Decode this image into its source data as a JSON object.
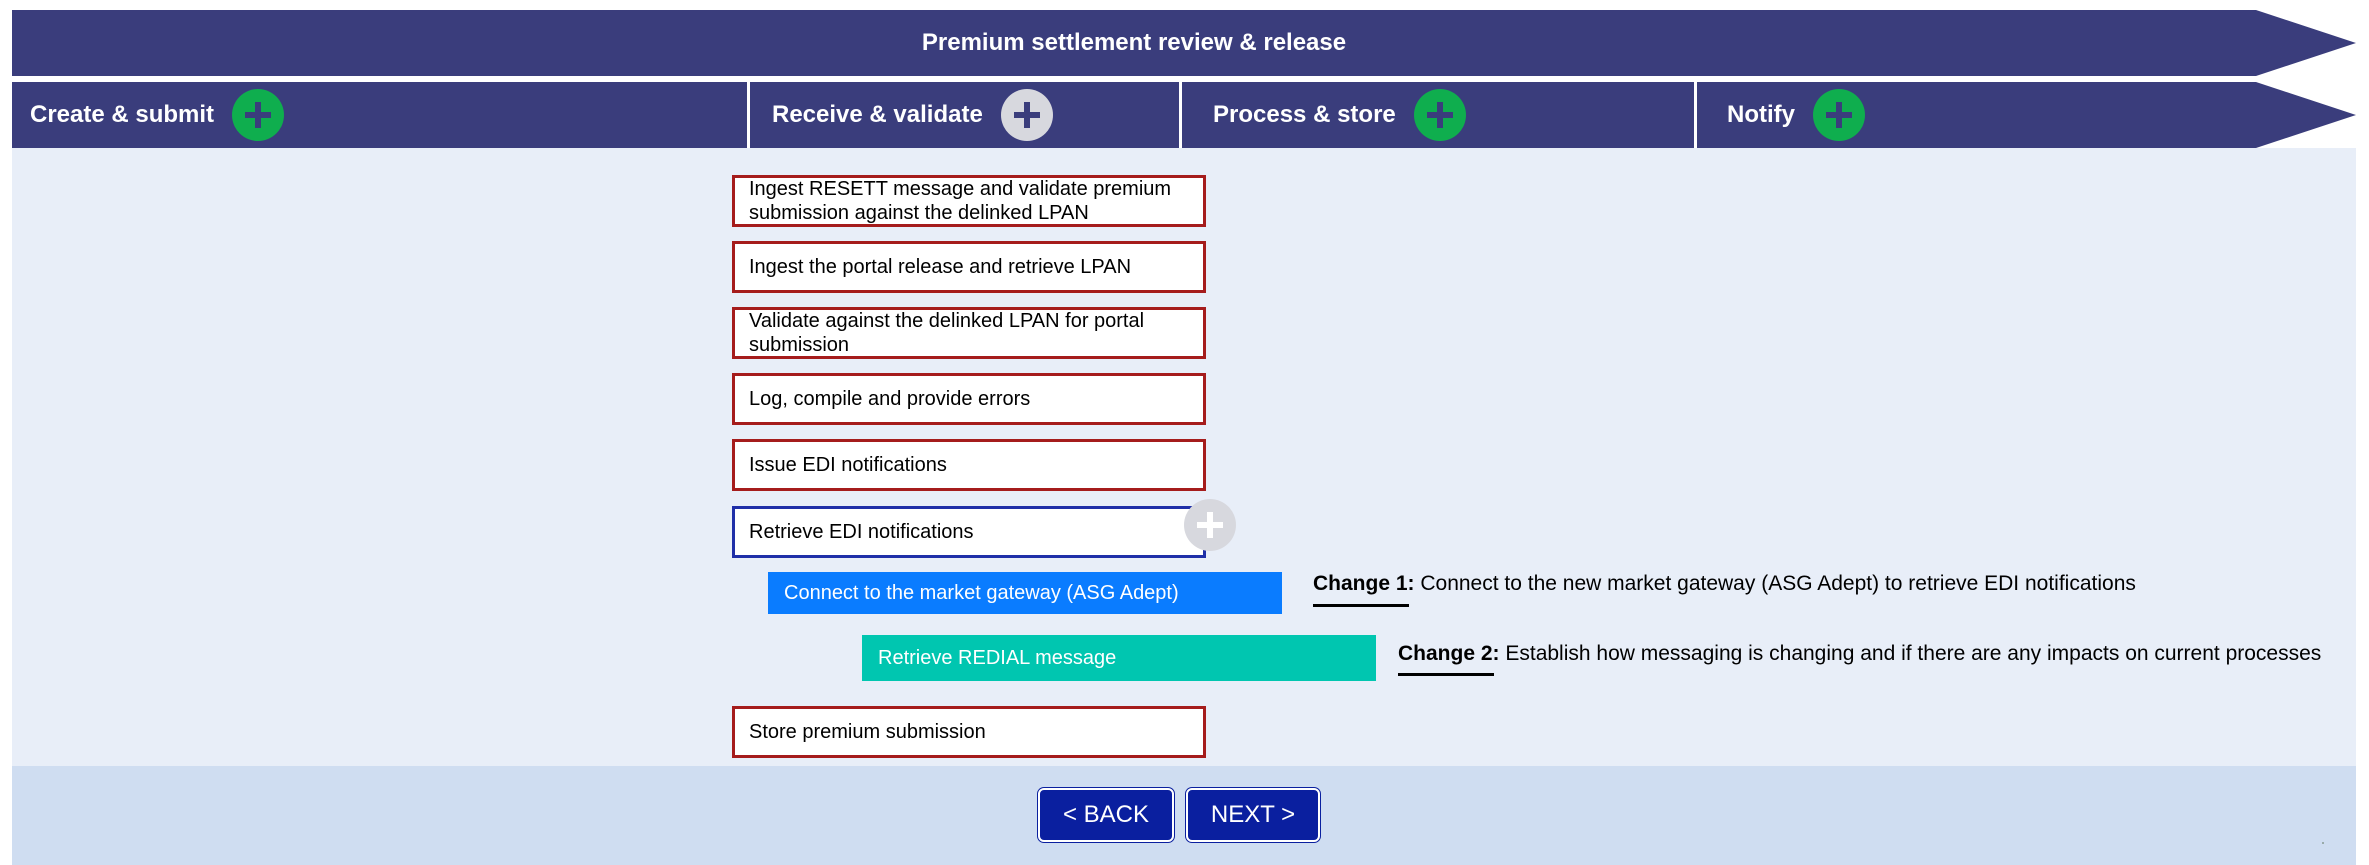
{
  "title": "Premium settlement review & release",
  "phases": [
    {
      "label": "Create & submit",
      "plus": "green-plus-icon"
    },
    {
      "label": "Receive & validate",
      "plus": "grey-plus-icon"
    },
    {
      "label": "Process & store",
      "plus": "green-plus-icon"
    },
    {
      "label": "Notify",
      "plus": "green-plus-icon"
    }
  ],
  "steps": [
    "Ingest RESETT message and validate premium submission against the delinked LPAN",
    "Ingest the portal release and retrieve LPAN",
    "Validate against the delinked LPAN for portal submission",
    "Log, compile and provide errors",
    "Issue EDI notifications",
    "Retrieve EDI notifications",
    "Store premium submission"
  ],
  "substeps": {
    "gateway": "Connect to the market gateway (ASG Adept)",
    "redial": "Retrieve REDIAL message"
  },
  "changes": [
    {
      "label": "Change 1:",
      "text": " Connect to the new market gateway (ASG Adept) to retrieve EDI notifications"
    },
    {
      "label": "Change 2:",
      "text": " Establish how messaging is changing and if there are any impacts on current processes"
    }
  ],
  "nav": {
    "back": "< BACK",
    "next": "NEXT >"
  },
  "colors": {
    "banner": "#3a3d7c",
    "green_plus": "#0fae4e",
    "step_border": "#a51c1c",
    "gateway": "#0a7cff",
    "redial": "#00c6b0",
    "nav_button": "#0a1f9f"
  }
}
